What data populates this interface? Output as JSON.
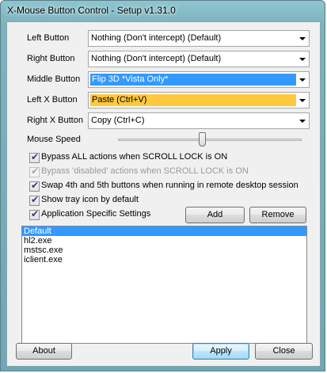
{
  "window": {
    "title": "X-Mouse Button Control - Setup v1.31.0"
  },
  "mappings": [
    {
      "label": "Left Button",
      "value": "Nothing (Don't intercept) (Default)",
      "highlight": "",
      "text_color": "#000000"
    },
    {
      "label": "Right Button",
      "value": "Nothing (Don't intercept) (Default)",
      "highlight": "",
      "text_color": "#000000"
    },
    {
      "label": "Middle Button",
      "value": "Flip 3D *Vista Only*",
      "highlight": "#3399ff",
      "text_color": "#ffffff"
    },
    {
      "label": "Left X Button",
      "value": "Paste (Ctrl+V)",
      "highlight": "#ffc83d",
      "text_color": "#000000"
    },
    {
      "label": "Right X Button",
      "value": "Copy (Ctrl+C)",
      "highlight": "",
      "text_color": "#000000"
    }
  ],
  "mouse_speed": {
    "label": "Mouse Speed",
    "level": 0.46
  },
  "options": [
    {
      "label": "Bypass ALL actions when SCROLL LOCK is ON",
      "checked": true,
      "disabled": false
    },
    {
      "label": "Bypass 'disabled' actions when SCROLL LOCK is ON",
      "checked": true,
      "disabled": true
    },
    {
      "label": "Swap 4th and 5th buttons when running in remote desktop session",
      "checked": true,
      "disabled": false
    },
    {
      "label": "Show tray icon by default",
      "checked": true,
      "disabled": false
    },
    {
      "label": "Application Specific Settings",
      "checked": true,
      "disabled": false
    }
  ],
  "app_buttons": {
    "add": "Add",
    "remove": "Remove"
  },
  "applications": [
    {
      "name": "Default",
      "selected": true
    },
    {
      "name": "hl2.exe",
      "selected": false
    },
    {
      "name": "mstsc.exe",
      "selected": false
    },
    {
      "name": "iclient.exe",
      "selected": false
    }
  ],
  "footer": {
    "about": "About",
    "apply": "Apply",
    "close": "Close"
  },
  "colors": {
    "selection": "#3399ff",
    "highlight_orange": "#ffc83d"
  }
}
